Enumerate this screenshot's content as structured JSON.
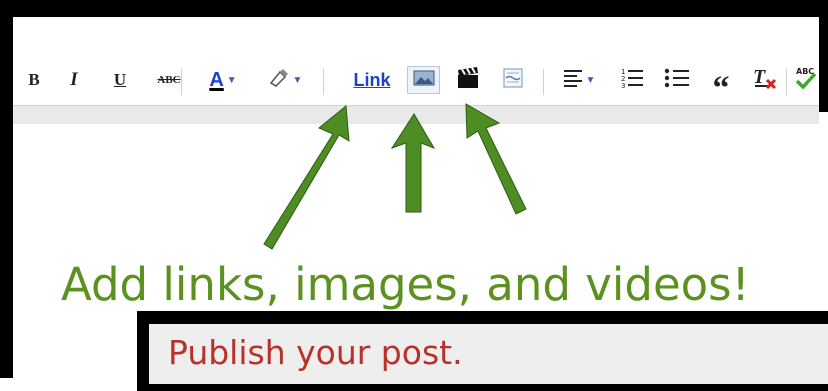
{
  "toolbar": {
    "bold": "B",
    "italic": "I",
    "underline": "U",
    "strikethrough": "ABC",
    "text_color": "A",
    "link": "Link",
    "icons": [
      "bold-icon",
      "italic-icon",
      "underline-icon",
      "strikethrough-icon",
      "text-color-icon",
      "highlight-icon",
      "link-button",
      "insert-image-icon",
      "insert-video-icon",
      "insert-jump-break-icon",
      "align-icon",
      "numbered-list-icon",
      "bullet-list-icon",
      "quote-icon",
      "remove-formatting-icon",
      "spellcheck-icon"
    ]
  },
  "annotation": {
    "caption": "Add links, images, and videos!",
    "publish": "Publish your post."
  },
  "colors": {
    "arrow": "#4e8d23",
    "caption": "#5c9120",
    "publish": "#b8322a",
    "link": "#1b3fd0"
  }
}
